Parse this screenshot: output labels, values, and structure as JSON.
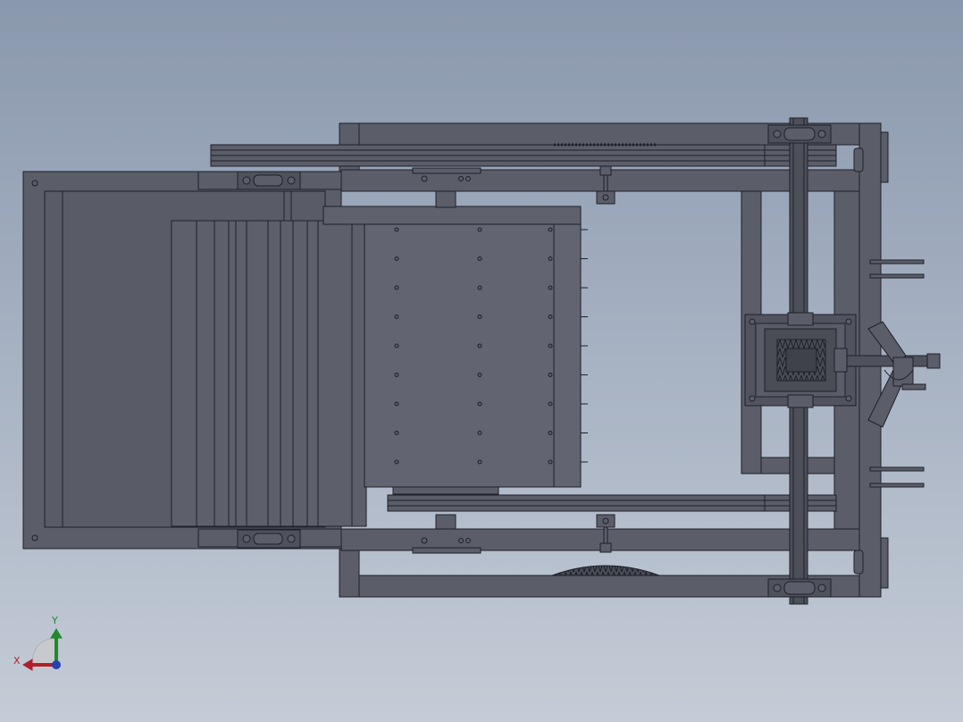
{
  "viewport": {
    "background_top": "#8a98ad",
    "background_bottom": "#c4ccd6",
    "model_fill": "#5b5e69",
    "model_fill_light": "#656874",
    "model_edge": "#1e2028"
  },
  "triad": {
    "x_label": "X",
    "y_label": "Y",
    "x_color": "#b0202a",
    "y_color": "#1f8a2a",
    "z_color": "#2a3fb0"
  }
}
